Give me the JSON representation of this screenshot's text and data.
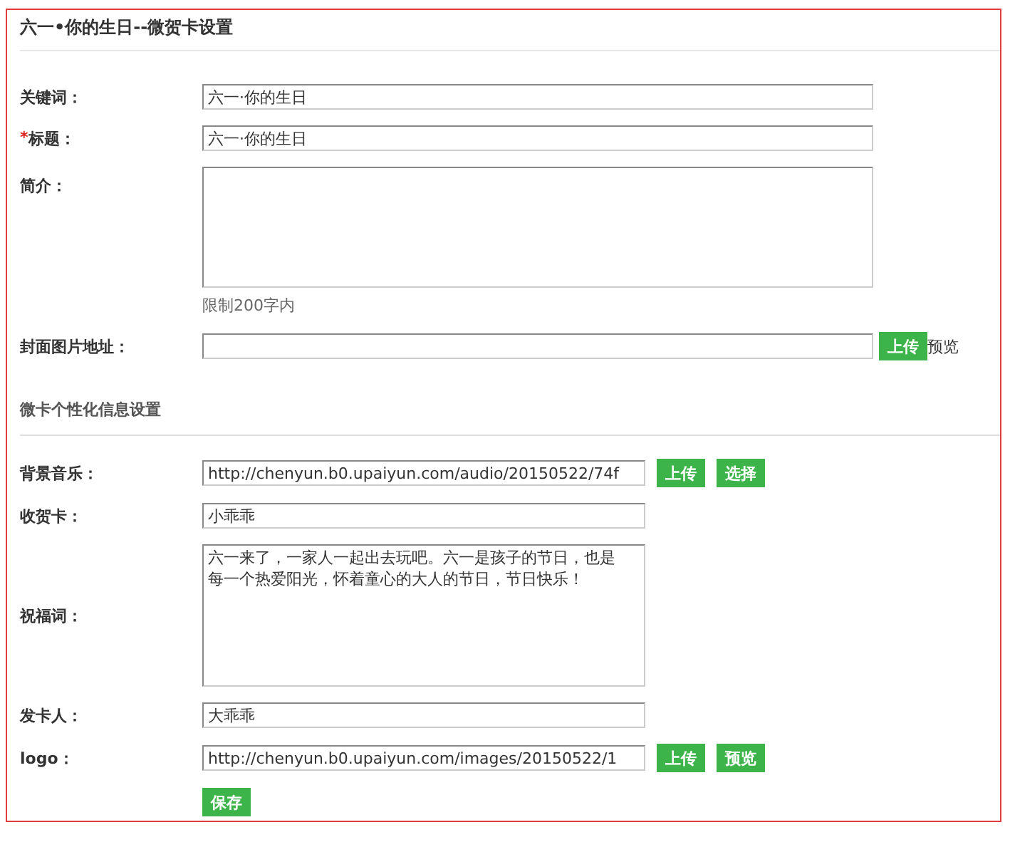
{
  "title": "六一•你的生日--微贺卡设置",
  "basic_fields": [
    {
      "label": "关键词：",
      "kind": "input",
      "value": "六一·你的生日"
    },
    {
      "label": "标题：",
      "required_mark": "*",
      "kind": "input",
      "value": "六一·你的生日"
    },
    {
      "label": "简介：",
      "kind": "textarea",
      "hint": "限制200字内"
    },
    {
      "label": "封面图片地址：",
      "kind": "input",
      "buttons": [
        "上传"
      ],
      "link": "预览"
    }
  ],
  "section_title": "微卡个性化信息设置",
  "custom_fields": [
    {
      "label": "背景音乐：",
      "kind": "input",
      "value": "http://chenyun.b0.upaiyun.com/audio/20150522/74f",
      "buttons": [
        "上传",
        "选择"
      ]
    },
    {
      "label": "收贺卡：",
      "kind": "input",
      "value": "小乖乖"
    },
    {
      "label": "祝福词：",
      "kind": "textarea",
      "value": "六一来了，一家人一起出去玩吧。六一是孩子的节日，也是每一个热爱阳光，怀着童心的大人的节日，节日快乐！"
    },
    {
      "label": "发卡人：",
      "kind": "input",
      "value": "大乖乖"
    },
    {
      "label": "logo：",
      "kind": "input",
      "value": "http://chenyun.b0.upaiyun.com/images/20150522/1",
      "buttons": [
        "上传",
        "预览"
      ]
    }
  ],
  "save_button": "保存"
}
